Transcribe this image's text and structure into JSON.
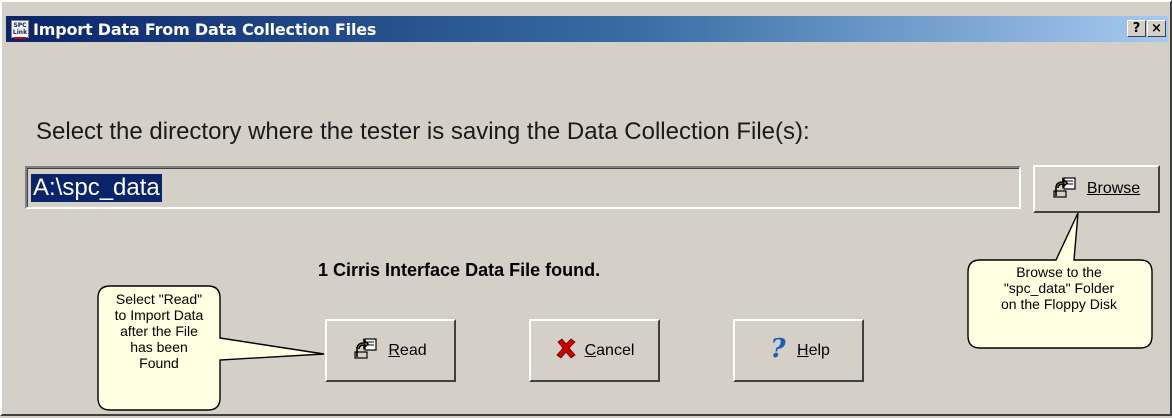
{
  "window": {
    "title": "Import Data From Data Collection Files",
    "icon_text": "SPC Link",
    "help_button": "?",
    "close_button": "×"
  },
  "main": {
    "prompt": "Select the directory where the tester is saving the Data Collection File(s):",
    "directory_value": "A:\\spc_data",
    "status": "1 Cirris Interface Data File found."
  },
  "buttons": {
    "browse": {
      "label": "Browse",
      "icon": "folder-open-icon"
    },
    "read": {
      "label": "Read",
      "icon": "folder-open-icon"
    },
    "cancel": {
      "label": "Cancel",
      "icon": "red-x-icon"
    },
    "help": {
      "label": "Help",
      "icon": "question-mark-icon"
    }
  },
  "callouts": {
    "read_hint": [
      "Select \"Read\"",
      "to Import Data",
      "after the File",
      "has been",
      "Found"
    ],
    "browse_hint": [
      "Browse to the",
      "\"spc_data\" Folder",
      "on the Floppy Disk"
    ]
  },
  "colors": {
    "face": "#d4d0c8",
    "title_start": "#0a246a",
    "title_end": "#a6caf0",
    "selection": "#0a246a",
    "callout_fill": "#ffffe1"
  }
}
